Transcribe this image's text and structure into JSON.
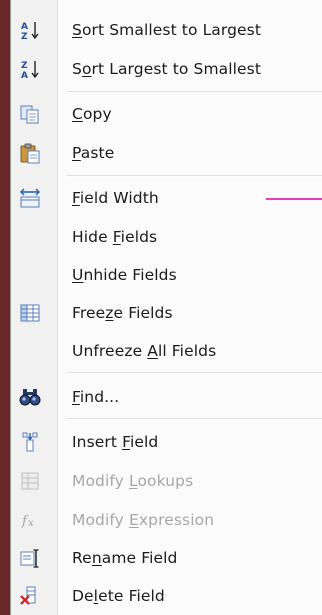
{
  "menu": {
    "items": [
      {
        "pre": "",
        "key": "S",
        "post": "ort Smallest to Largest",
        "icon": "sort-ascending-icon",
        "disabled": false
      },
      {
        "pre": "S",
        "key": "o",
        "post": "rt Largest to Smallest",
        "icon": "sort-descending-icon",
        "disabled": false
      },
      {
        "pre": "",
        "key": "C",
        "post": "opy",
        "icon": "copy-icon",
        "disabled": false
      },
      {
        "pre": "",
        "key": "P",
        "post": "aste",
        "icon": "paste-icon",
        "disabled": false
      },
      {
        "pre": "",
        "key": "F",
        "post": "ield Width",
        "icon": "field-width-icon",
        "disabled": false
      },
      {
        "pre": "Hide ",
        "key": "F",
        "post": "ields",
        "icon": "",
        "disabled": false
      },
      {
        "pre": "",
        "key": "U",
        "post": "nhide Fields",
        "icon": "",
        "disabled": false
      },
      {
        "pre": "Free",
        "key": "z",
        "post": "e Fields",
        "icon": "freeze-fields-icon",
        "disabled": false
      },
      {
        "pre": "Unfreeze ",
        "key": "A",
        "post": "ll Fields",
        "icon": "",
        "disabled": false
      },
      {
        "pre": "",
        "key": "F",
        "post": "ind...",
        "icon": "find-binoculars-icon",
        "disabled": false
      },
      {
        "pre": "Insert ",
        "key": "F",
        "post": "ield",
        "icon": "insert-field-icon",
        "disabled": false
      },
      {
        "pre": "Modify ",
        "key": "L",
        "post": "ookups",
        "icon": "modify-lookups-icon",
        "disabled": true
      },
      {
        "pre": "Modify ",
        "key": "E",
        "post": "xpression",
        "icon": "modify-expression-icon",
        "disabled": true
      },
      {
        "pre": "Re",
        "key": "n",
        "post": "ame Field",
        "icon": "rename-field-icon",
        "disabled": false
      },
      {
        "pre": "De",
        "key": "l",
        "post": "ete Field",
        "icon": "delete-field-icon",
        "disabled": false
      }
    ]
  }
}
